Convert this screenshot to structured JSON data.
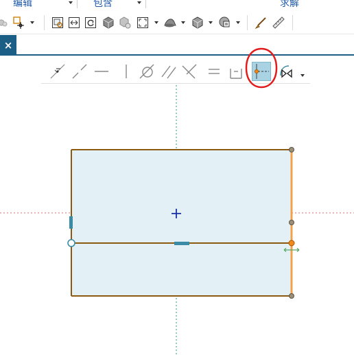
{
  "menu": {
    "edit_label": "编辑",
    "include_label": "包含",
    "solve_label": "求解"
  },
  "tab": {
    "close_glyph": "×"
  },
  "toolbar_icons": [
    "measure-snap-icon",
    "point-target-icon",
    "sketch-view-icon",
    "fit-width-icon",
    "refresh-icon",
    "shaded-cube-icon",
    "gear-cube-icon",
    "zoom-extents-icon",
    "surface-icon",
    "solid-cube-icon",
    "camera-view-icon",
    "brush-icon",
    "ruler-icon"
  ],
  "constraint_icons": [
    "coincident-icon",
    "collinear-icon",
    "horizontal-icon",
    "vertical-icon",
    "tangent-icon",
    "parallel-icon",
    "perpendicular-icon",
    "equal-icon",
    "symmetric-icon",
    "midpoint-on-line-icon",
    "mirror-icon"
  ],
  "selected_constraint": "midpoint-on-line-icon",
  "colors": {
    "menu_text": "#1f5aa6",
    "tab_accent": "#1c5f86",
    "sketch_fill": "#e3f1f6",
    "sketch_edge": "#8b5a10",
    "selected_edge": "#f2a24a",
    "axis_vertical": "#2e9e6a",
    "axis_horizontal": "#e06a6a",
    "constraint_marker": "#3a8ca6",
    "annotation_ring": "#e21c1c"
  }
}
